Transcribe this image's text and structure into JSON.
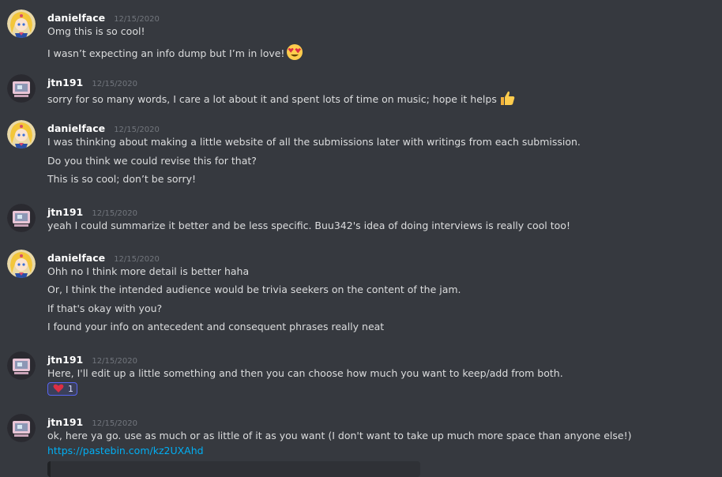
{
  "colors": {
    "background": "#36393f",
    "username": "#ffffff",
    "timestamp": "#72767d",
    "text": "#dcddde",
    "link": "#00aff4"
  },
  "messages": [
    {
      "author": "danielface",
      "timestamp": "12/15/2020",
      "avatar": "sailor-moon-avatar",
      "lines": [
        "Omg this is so cool!",
        "I wasn’t expecting an info dump but I’m in love!"
      ]
    },
    {
      "author": "jtn191",
      "timestamp": "12/15/2020",
      "avatar": "retro-computer-avatar",
      "lines": [
        "sorry for so many words, I care a lot about it and spent lots of time on music; hope it helps"
      ]
    },
    {
      "author": "danielface",
      "timestamp": "12/15/2020",
      "avatar": "sailor-moon-avatar",
      "lines": [
        "I was thinking about making a little website of all the submissions later with writings from each submission.",
        "Do you think we could revise this for that?",
        "This is so cool; don’t be sorry!"
      ]
    },
    {
      "author": "jtn191",
      "timestamp": "12/15/2020",
      "avatar": "retro-computer-avatar",
      "lines": [
        "yeah I could summarize it better and be less specific. Buu342's idea of doing interviews is really cool too!"
      ]
    },
    {
      "author": "danielface",
      "timestamp": "12/15/2020",
      "avatar": "sailor-moon-avatar",
      "lines": [
        "Ohh no I think more detail is better haha",
        "Or, I think the intended audience would be trivia seekers on the content of the jam.",
        "If that's okay with you?",
        "I found your info on antecedent and consequent phrases really neat"
      ]
    },
    {
      "author": "jtn191",
      "timestamp": "12/15/2020",
      "avatar": "retro-computer-avatar",
      "lines": [
        "Here, I'll edit up a little something and then you can choose how much you want to keep/add from both."
      ],
      "reaction": {
        "icon": "heart-icon",
        "count": "1"
      }
    },
    {
      "author": "jtn191",
      "timestamp": "12/15/2020",
      "avatar": "retro-computer-avatar",
      "lines": [
        "ok, here ya go. use as much or as little of it as you want (I don't want to take up much more space than anyone else!)"
      ],
      "link": "https://pastebin.com/kz2UXAhd"
    }
  ]
}
